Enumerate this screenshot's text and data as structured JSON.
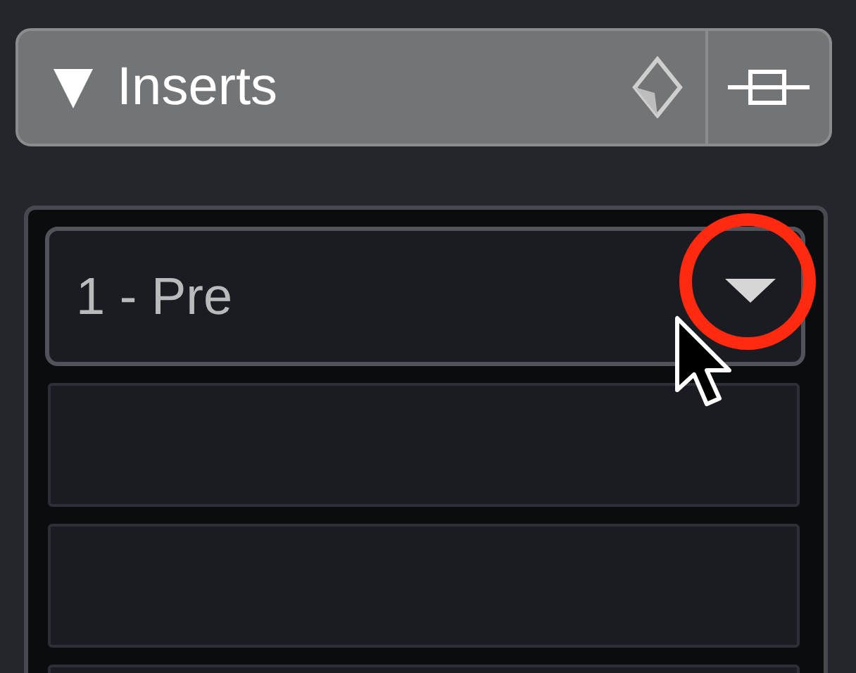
{
  "inserts_header": {
    "title": "Inserts",
    "expanded": true
  },
  "slots": [
    {
      "kind": "selector",
      "label": "1 - Pre"
    },
    {
      "kind": "empty"
    },
    {
      "kind": "empty"
    },
    {
      "kind": "empty"
    }
  ]
}
